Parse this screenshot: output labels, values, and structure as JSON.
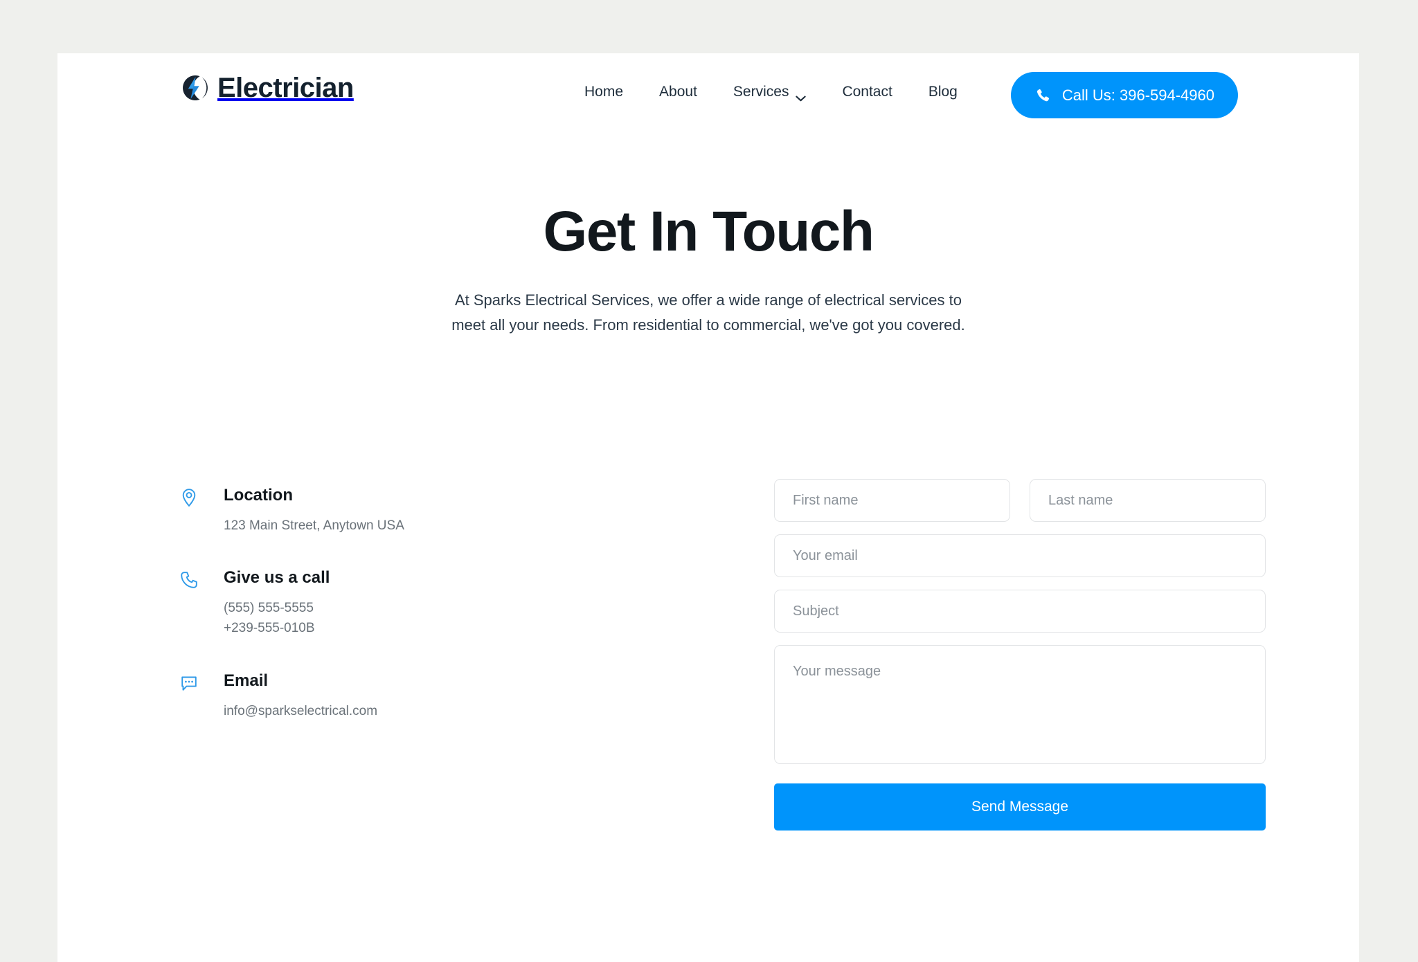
{
  "theme": {
    "accent_blue": "#0094fb",
    "page_background": "#eff0ed",
    "canvas_background": "#ffffff",
    "heading_color": "#12181d",
    "muted_text": "#6a7279"
  },
  "header": {
    "brand": {
      "name": "Electrician",
      "logo_icon": "lightning-bolt-circle-logo"
    },
    "nav": [
      {
        "label": "Home",
        "has_dropdown": false
      },
      {
        "label": "About",
        "has_dropdown": false
      },
      {
        "label": "Services",
        "has_dropdown": true
      },
      {
        "label": "Contact",
        "has_dropdown": false
      },
      {
        "label": "Blog",
        "has_dropdown": false
      }
    ],
    "call_button": {
      "label": "Call Us: 396-594-4960",
      "icon": "phone-icon"
    }
  },
  "hero": {
    "title": "Get In Touch",
    "subtitle": "At Sparks Electrical Services, we offer a wide range of electrical services to meet all your needs. From residential to commercial, we've got you covered."
  },
  "contact_info": [
    {
      "icon": "map-pin-icon",
      "title": "Location",
      "lines": [
        "123 Main Street, Anytown USA"
      ]
    },
    {
      "icon": "phone-icon",
      "title": "Give us a call",
      "lines": [
        "(555) 555-5555",
        "+239-555-010B"
      ]
    },
    {
      "icon": "chat-bubble-icon",
      "title": "Email",
      "lines": [
        "info@sparkselectrical.com"
      ]
    }
  ],
  "form": {
    "first_name": {
      "placeholder": "First name",
      "value": ""
    },
    "last_name": {
      "placeholder": "Last name",
      "value": ""
    },
    "email": {
      "placeholder": "Your email",
      "value": ""
    },
    "subject": {
      "placeholder": "Subject",
      "value": ""
    },
    "message": {
      "placeholder": "Your message",
      "value": ""
    },
    "submit_label": "Send Message"
  }
}
